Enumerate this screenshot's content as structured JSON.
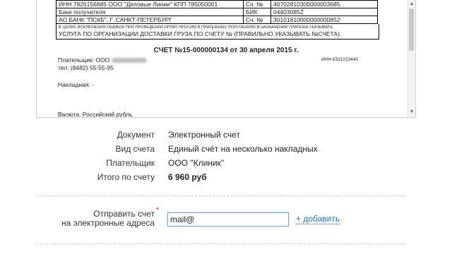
{
  "invoice": {
    "bank_rows": [
      {
        "left": "ИНН 7826156685 ООО \"Деловые Линии\" КПП 785050001",
        "code": "Сч. №",
        "value": "40702810300000003685"
      },
      {
        "left": "Банк получателя",
        "code": "БИК",
        "value": "044030852"
      },
      {
        "left": "АО БАНК \"ПСКБ\", Г. САНКТ-ПЕТЕРБУРГ",
        "code": "Сч. №",
        "value": "30101810000000000852"
      }
    ],
    "notice_small": "В ЦЕЛЯХ ИСКЛЮЧЕНИЯ ОШИБОК ПРИ ПРОВЕДЕНИИ ОПЛАТ ПРОСИМ В ПЛАТЕЖНЫХ ПОРУЧЕНИЯХ В НАЗНАЧЕНИИ ПЛАТЕЖА УКАЗЫВАТЬ",
    "notice_big": "УСЛУГА ПО ОРГАНИЗАЦИИ ДОСТАВКИ ГРУЗА ПО СЧЕТУ № (ПРАВИЛЬНО УКАЗЫВАТЬ №СЧЕТА).",
    "title": "СЧЕТ №15-000000134 от 30 апреля 2015 г.",
    "payer": "Плательщик: ООО",
    "inn": "ИНН 6321223440",
    "phone": "тел: (8482) 55-55-95",
    "waybill": "Накладная: -",
    "currency": "Валюта: Российский рубль"
  },
  "details": {
    "document_label": "Документ",
    "document_value": "Электронный счет",
    "type_label": "Вид счета",
    "type_value": "Единый счёт на несколько накладных",
    "payer_label": "Плательщик",
    "payer_value": "ООО \"Клиник\"",
    "total_label": "Итого по счету",
    "total_value": "6 960 руб"
  },
  "send": {
    "label_line1": "Отправить счет",
    "label_line2": "на электронные адреса",
    "required_mark": "*",
    "email_value": "mail@",
    "add_link": "+ добавить"
  },
  "icons": {
    "scroll_up": "scroll-up-arrow-icon",
    "scroll_down": "scroll-down-arrow-icon"
  }
}
